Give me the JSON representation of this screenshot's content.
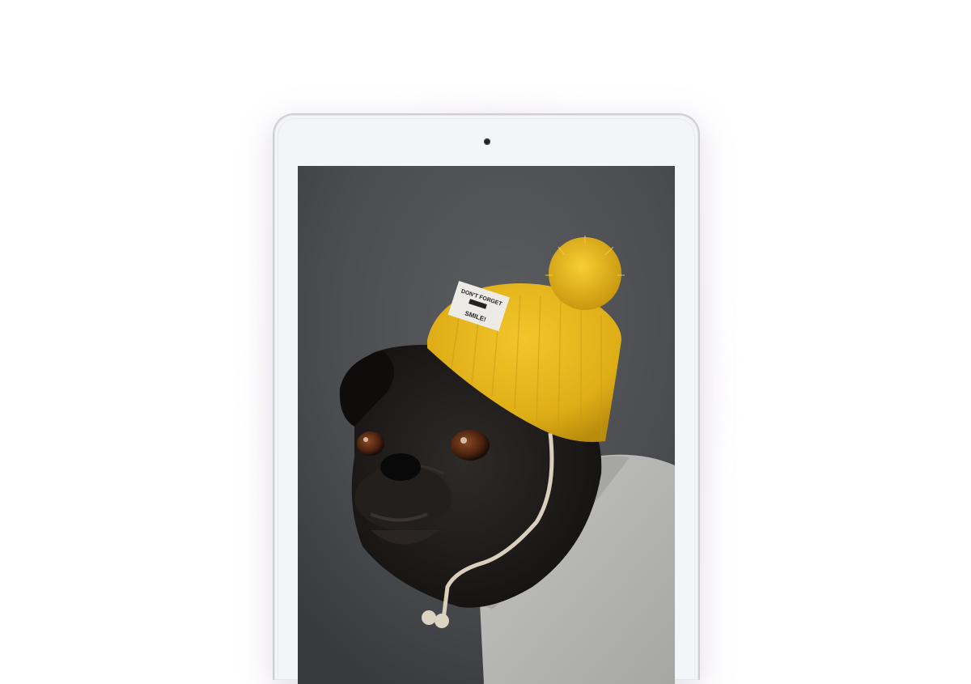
{
  "device": {
    "type": "tablet",
    "color": "#f4f5f8",
    "bezel_border": "#cfd0d4"
  },
  "screen": {
    "content": "photo",
    "subject": "pug wearing yellow pom-pom beanie and grey sweater",
    "hat_patch_text": "DON'T FORGET SMILE!",
    "colors": {
      "background": "#4b4d51",
      "hat": "#e6b51c",
      "sweater": "#b8b8b6",
      "dog": "#1c1a19"
    }
  },
  "page": {
    "background": "#ffffff",
    "glow": "#cdb9d7"
  }
}
